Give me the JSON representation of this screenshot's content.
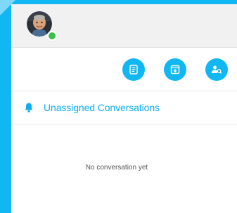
{
  "colors": {
    "accent": "#10b7f2",
    "online": "#3fbf4a",
    "topbar_bg": "#f1f1f1"
  },
  "header": {
    "avatar_icon": "user-avatar",
    "status": "online"
  },
  "toolbar": {
    "actions": [
      {
        "icon": "note-icon"
      },
      {
        "icon": "archive-icon"
      },
      {
        "icon": "user-search-icon"
      }
    ]
  },
  "section": {
    "icon": "bell-icon",
    "title": "Unassigned Conversations"
  },
  "empty_state": {
    "message": "No conversation yet"
  }
}
